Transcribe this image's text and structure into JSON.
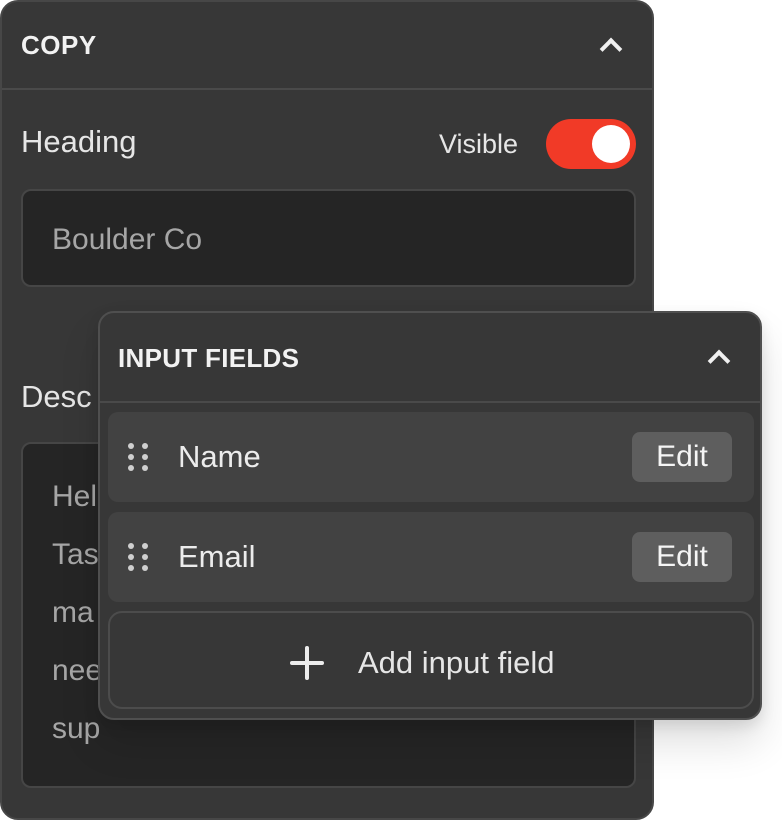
{
  "copy_panel": {
    "title": "COPY",
    "heading": {
      "label": "Heading",
      "visible_label": "Visible",
      "visible_on": true,
      "value": "Boulder Co"
    },
    "description": {
      "label": "Desc",
      "lines": [
        "Hel",
        "Tas",
        "ma",
        "nee",
        "sup"
      ]
    }
  },
  "input_fields_panel": {
    "title": "INPUT FIELDS",
    "fields": [
      {
        "label": "Name",
        "edit_label": "Edit"
      },
      {
        "label": "Email",
        "edit_label": "Edit"
      }
    ],
    "add_label": "Add input field"
  },
  "colors": {
    "accent": "#f13a27",
    "panel_bg": "#373737",
    "input_bg": "#252525"
  }
}
